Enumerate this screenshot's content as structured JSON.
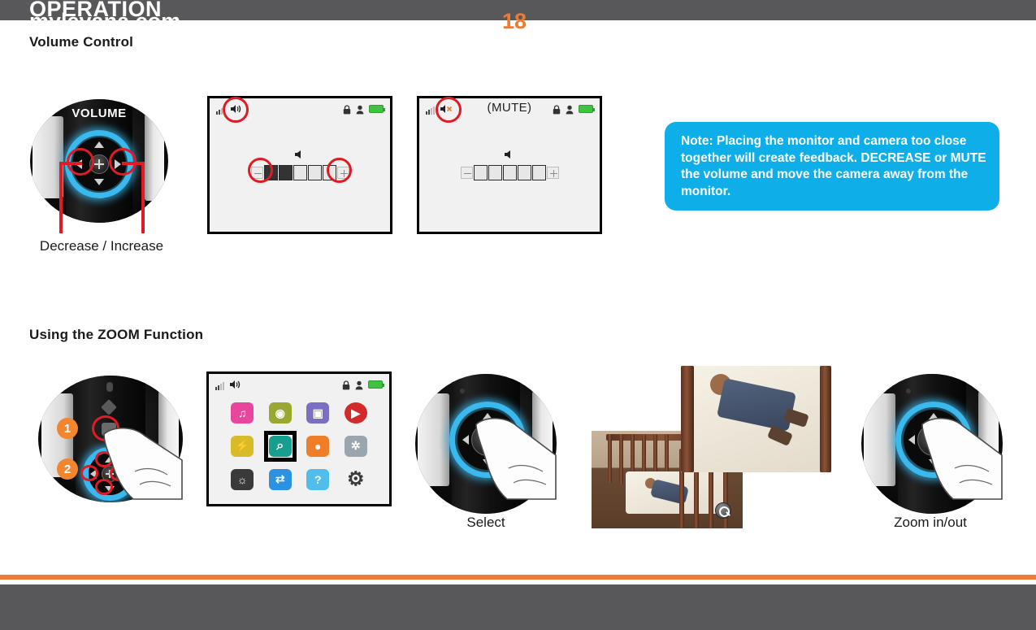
{
  "header": {
    "title": "OPERATION"
  },
  "sections": {
    "volume": {
      "heading": "Volume Control"
    },
    "zoom": {
      "heading": "Using the ZOOM Function"
    }
  },
  "volume_pad": {
    "label": "VOLUME",
    "caption": "Decrease / Increase",
    "annotations": [
      "decrease-arrow",
      "increase-arrow"
    ]
  },
  "volume_screen": {
    "status_icons": [
      "signal-icon",
      "speaker-icon",
      "lock-icon",
      "night-person-icon",
      "battery-icon"
    ],
    "speaker_icon": "speaker-icon",
    "minus_label": "-",
    "plus_label": "+",
    "segments_filled": 2,
    "segments_total": 5
  },
  "mute_screen": {
    "title": "(MUTE)",
    "status_icons": [
      "signal-icon",
      "speaker-mute-icon",
      "lock-icon",
      "night-person-icon",
      "battery-icon"
    ],
    "speaker_icon": "speaker-icon",
    "minus_label": "-",
    "plus_label": "+",
    "segments_filled": 0,
    "segments_total": 5
  },
  "note": {
    "text": "Note: Placing the monitor and camera too close together will create feedback. DECREASE or MUTE the volume and move the camera away from the monitor."
  },
  "zoom_pad_steps": {
    "badge_one": "1",
    "badge_two": "2"
  },
  "menu_screen": {
    "status_icons": [
      "signal-icon",
      "speaker-icon",
      "lock-icon",
      "night-person-icon",
      "battery-icon"
    ],
    "selected_icon": "zoom-magnifier-icon",
    "icons": [
      {
        "name": "lullaby-icon",
        "glyph": "♫",
        "color": "#e8459c"
      },
      {
        "name": "camera-icon",
        "glyph": "◉",
        "color": "#9aa832"
      },
      {
        "name": "video-record-icon",
        "glyph": "▣",
        "color": "#7b6fc4"
      },
      {
        "name": "playback-icon",
        "glyph": "▶",
        "color": "#d32b2b"
      },
      {
        "name": "flash-off-icon",
        "glyph": "⚡",
        "color": "#d9bb2a"
      },
      {
        "name": "zoom-magnifier-icon",
        "glyph": "⌕",
        "color": "#169e8e"
      },
      {
        "name": "night-light-icon",
        "glyph": "●",
        "color": "#f07d27"
      },
      {
        "name": "fan-icon",
        "glyph": "✲",
        "color": "#9aa6ad"
      },
      {
        "name": "brightness-icon",
        "glyph": "☀",
        "color": "#3a3a3a"
      },
      {
        "name": "pairing-icon",
        "glyph": "⇄",
        "color": "#2b91e0"
      },
      {
        "name": "help-icon",
        "glyph": "?",
        "color": "#51bdea"
      },
      {
        "name": "settings-gear-icon",
        "glyph": "⚙",
        "color": "#f1f1f1"
      }
    ]
  },
  "select_pad": {
    "caption": "Select"
  },
  "zoom_pad": {
    "caption": "Zoom in/out"
  },
  "photos": {
    "wide_name": "crib-wide-view-photo",
    "zoomed_name": "crib-zoomed-view-photo",
    "zoom_badge": "zoom-indicator-icon"
  },
  "footer": {
    "site": "mylevana.com",
    "page": "18"
  },
  "colors": {
    "header_gray": "#58585a",
    "accent_orange": "#ef7a35",
    "note_blue": "#0eaee8",
    "ring_blue": "#39b9ee",
    "annotation_red": "#e01b24",
    "badge_orange": "#f2862f"
  }
}
